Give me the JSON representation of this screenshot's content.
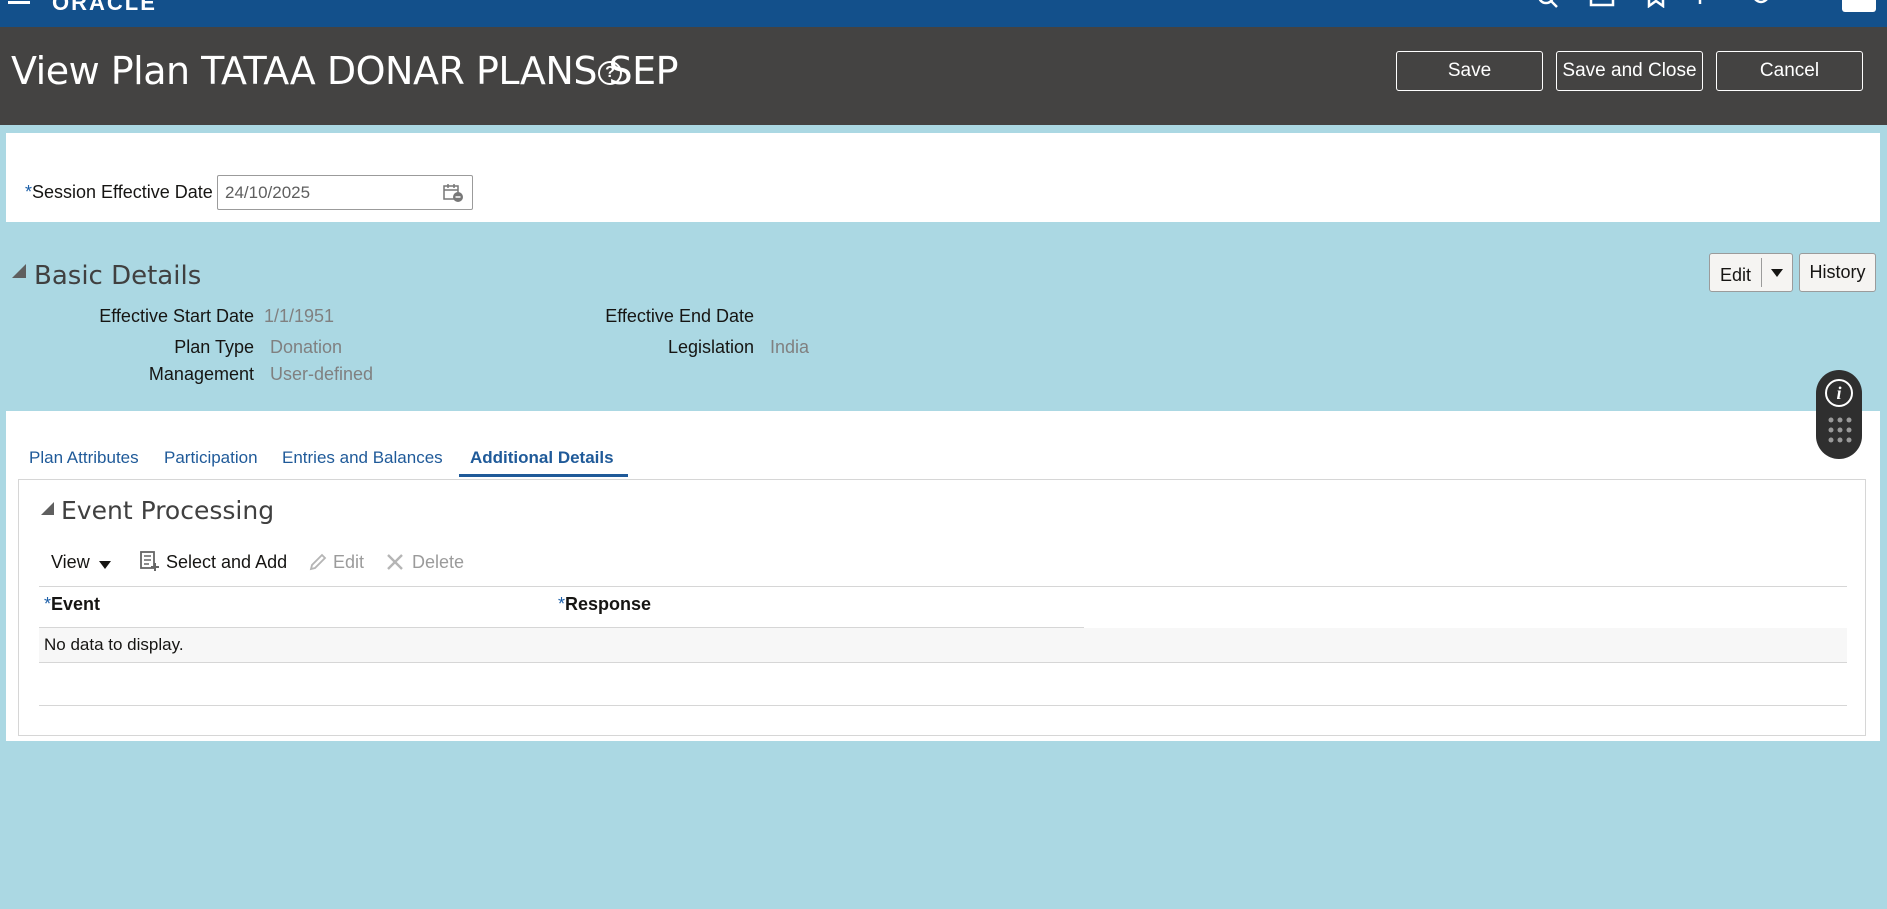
{
  "topbar": {
    "logo": "ORACLE"
  },
  "header": {
    "title": "View Plan TATAA DONAR PLANS SEP",
    "help": "?",
    "save": "Save",
    "save_close": "Save and Close",
    "cancel": "Cancel"
  },
  "session": {
    "required": "*",
    "label": "Session Effective Date",
    "value": "24/10/2025"
  },
  "basic_details": {
    "title": "Basic Details",
    "edit": "Edit",
    "history": "History",
    "fields": {
      "effective_start_label": "Effective Start Date",
      "effective_start_value": "1/1/1951",
      "effective_end_label": "Effective End Date",
      "plan_type_label": "Plan Type",
      "plan_type_value": "Donation",
      "legislation_label": "Legislation",
      "legislation_value": "India",
      "management_label": "Management",
      "management_value": "User-defined"
    }
  },
  "tabs": [
    {
      "label": "Plan Attributes"
    },
    {
      "label": "Participation"
    },
    {
      "label": "Entries and Balances"
    },
    {
      "label": "Additional Details"
    }
  ],
  "event_processing": {
    "title": "Event Processing",
    "toolbar": {
      "view": "View",
      "select_add": "Select and Add",
      "edit": "Edit",
      "delete": "Delete"
    },
    "columns": [
      {
        "required": "*",
        "label": "Event"
      },
      {
        "required": "*",
        "label": "Response"
      }
    ],
    "empty_message": "No data to display."
  },
  "info_widget": {
    "label": "i"
  }
}
